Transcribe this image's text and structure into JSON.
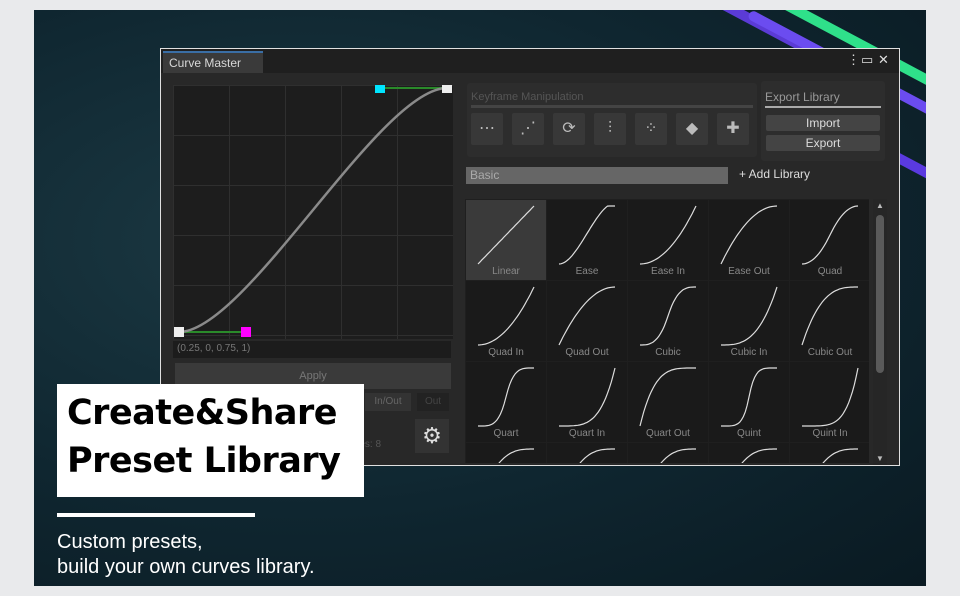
{
  "window": {
    "title": "Curve Master",
    "menu_icon": "kebab-icon",
    "maximize_icon": "maximize-icon",
    "close_icon": "close-icon"
  },
  "editor": {
    "readout": "(0.25, 0, 0.75, 1)",
    "apply_label": "Apply",
    "inout_label": "In/Out",
    "out_label": "Out",
    "segments_label": "...es: 8",
    "handle_in_color": "#ff00ff",
    "handle_out_color": "#00e5ff",
    "curve": [
      0.25,
      0,
      0.75,
      1
    ]
  },
  "keyframe": {
    "title": "Keyframe Manipulation",
    "buttons": [
      "align-horizontal-icon",
      "align-diagonal-icon",
      "refresh-icon",
      "flip-vertical-icon",
      "distribute-icon",
      "mirror-icon",
      "add-icon"
    ]
  },
  "export_library": {
    "title": "Export Library",
    "import_label": "Import",
    "export_label": "Export"
  },
  "library": {
    "selected": "Basic",
    "add_label": "+ Add Library"
  },
  "presets": [
    "Linear",
    "Ease",
    "Ease In",
    "Ease Out",
    "Quad",
    "Quad In",
    "Quad Out",
    "Cubic",
    "Cubic In",
    "Cubic Out",
    "Quart",
    "Quart In",
    "Quart Out",
    "Quint",
    "Quint In",
    "",
    "",
    "",
    "",
    ""
  ],
  "promo": {
    "headline_1": "Create&Share",
    "headline_2": "Preset Library",
    "subtitle_1": "Custom presets,",
    "subtitle_2": "build your own curves library."
  }
}
